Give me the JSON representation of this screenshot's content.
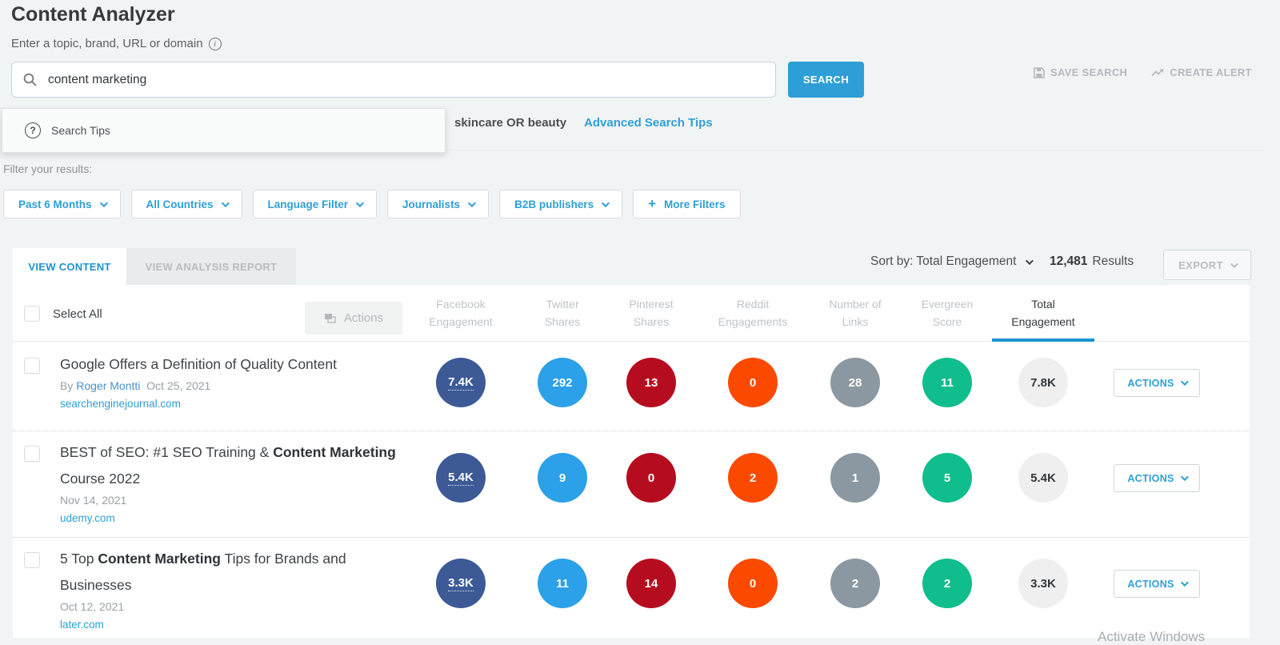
{
  "page": {
    "title": "Content Analyzer",
    "subtitle": "Enter a topic, brand, URL or domain",
    "watermark": "Activate Windows"
  },
  "search": {
    "value": "content marketing",
    "button_label": "SEARCH",
    "save_search_label": "SAVE SEARCH",
    "create_alert_label": "CREATE ALERT",
    "tips_label": "Search Tips",
    "example_text": "skincare OR beauty",
    "advanced_link": "Advanced Search Tips"
  },
  "filters": {
    "label": "Filter your results:",
    "items": [
      "Past 6 Months",
      "All Countries",
      "Language Filter",
      "Journalists",
      "B2B publishers"
    ],
    "more_label": "More Filters"
  },
  "tabs": {
    "view_content": "VIEW CONTENT",
    "view_analysis": "VIEW ANALYSIS REPORT"
  },
  "toolbar": {
    "sort_label": "Sort by: Total Engagement",
    "results_count": "12,481",
    "results_suffix": "Results",
    "export_label": "EXPORT"
  },
  "table": {
    "select_all_label": "Select All",
    "actions_label": "Actions",
    "row_actions_label": "ACTIONS",
    "columns": [
      {
        "line1": "Facebook",
        "line2": "Engagement",
        "active": false
      },
      {
        "line1": "Twitter",
        "line2": "Shares",
        "active": false
      },
      {
        "line1": "Pinterest",
        "line2": "Shares",
        "active": false
      },
      {
        "line1": "Reddit",
        "line2": "Engagements",
        "active": false
      },
      {
        "line1": "Number of",
        "line2": "Links",
        "active": false
      },
      {
        "line1": "Evergreen",
        "line2": "Score",
        "active": false
      },
      {
        "line1": "Total",
        "line2": "Engagement",
        "active": true
      }
    ],
    "metric_colors": [
      "#3d5a97",
      "#2ca0e8",
      "#b50d1f",
      "#fb4a00",
      "#8c98a1",
      "#10bd8d",
      "#efefef"
    ],
    "rows": [
      {
        "title_parts": [
          {
            "t": "Google Offers a Definition of Quality Content",
            "b": false
          }
        ],
        "byline_prefix": "By",
        "author": "Roger Montti",
        "date": "Oct 25, 2021",
        "domain": "searchenginejournal.com",
        "metrics": [
          "7.4K",
          "292",
          "13",
          "0",
          "28",
          "11",
          "7.8K"
        ]
      },
      {
        "title_parts": [
          {
            "t": "BEST of SEO: #1 SEO Training & ",
            "b": false
          },
          {
            "t": "Content Marketing",
            "b": true
          },
          {
            "t": " Course 2022",
            "b": false
          }
        ],
        "byline_prefix": "",
        "author": "",
        "date": "Nov 14, 2021",
        "domain": "udemy.com",
        "metrics": [
          "5.4K",
          "9",
          "0",
          "2",
          "1",
          "5",
          "5.4K"
        ]
      },
      {
        "title_parts": [
          {
            "t": "5 Top ",
            "b": false
          },
          {
            "t": "Content Marketing",
            "b": true
          },
          {
            "t": " Tips for Brands and Businesses",
            "b": false
          }
        ],
        "byline_prefix": "",
        "author": "",
        "date": "Oct 12, 2021",
        "domain": "later.com",
        "metrics": [
          "3.3K",
          "11",
          "14",
          "0",
          "2",
          "2",
          "3.3K"
        ]
      }
    ]
  },
  "colors": {
    "accent_blue": "#2e9fd6",
    "tab_underline": "#1b93d1",
    "facebook": "#3d5a97",
    "twitter": "#2ca0e8",
    "pinterest": "#b50d1f",
    "reddit": "#fb4a00",
    "links": "#8c98a1",
    "evergreen": "#10bd8d",
    "total_circle_bg": "#efefef",
    "page_bg": "#f1f4f5"
  }
}
